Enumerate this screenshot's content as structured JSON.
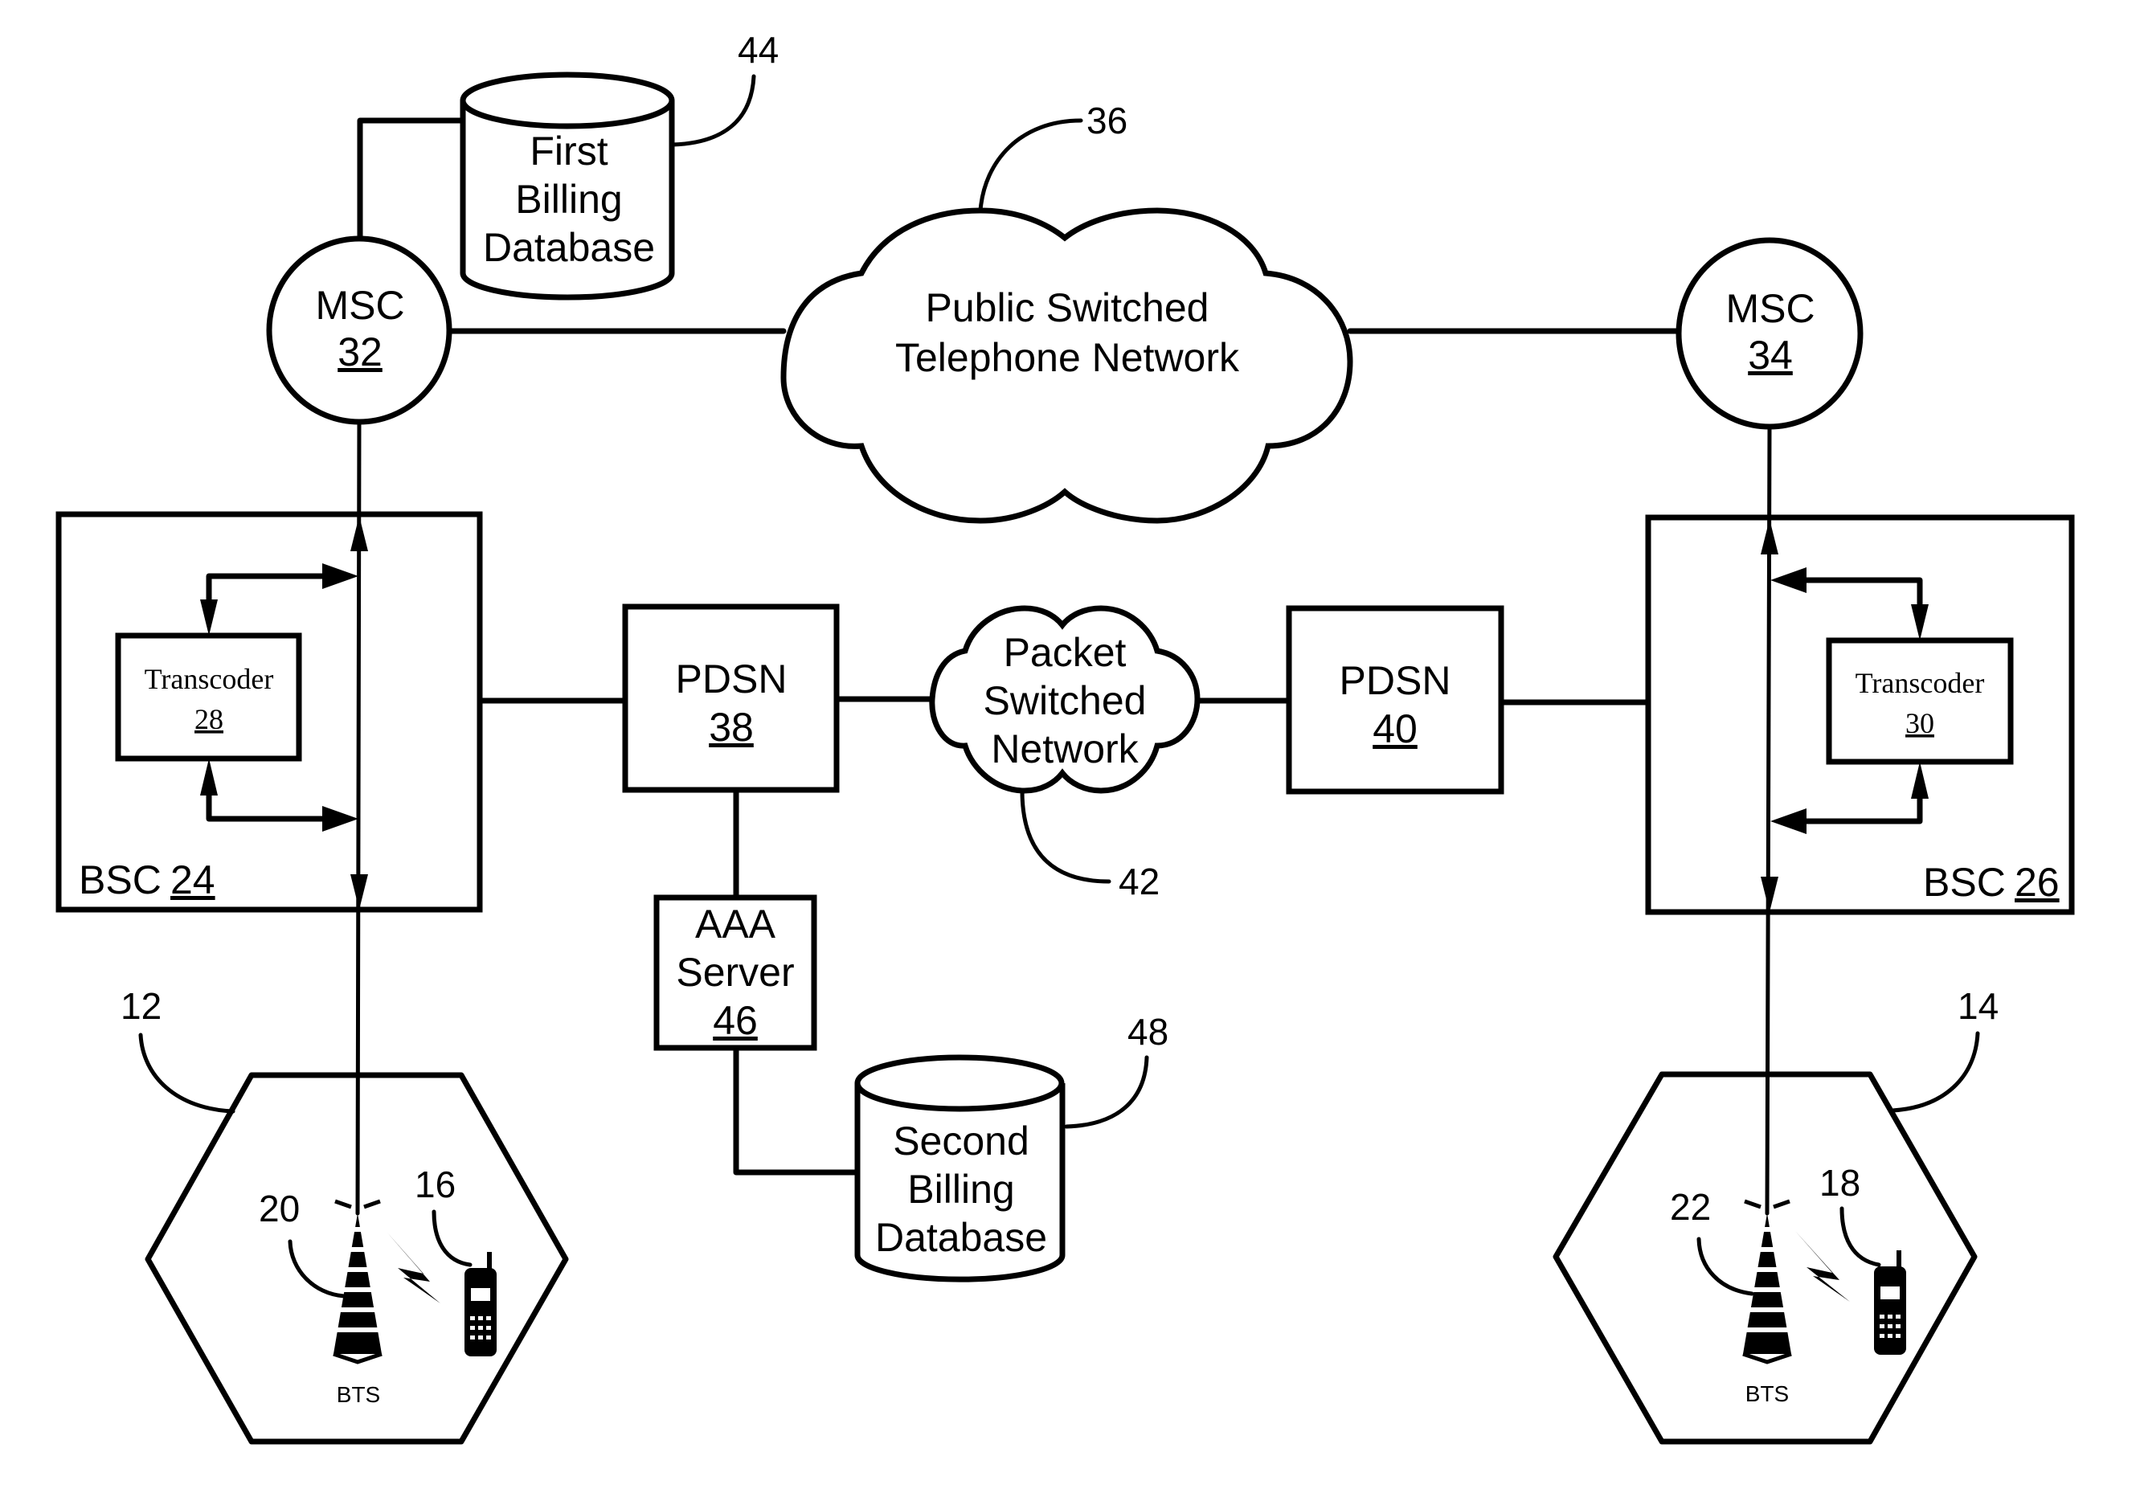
{
  "figure": {
    "msc_left": {
      "name": "MSC",
      "ref": "32"
    },
    "msc_right": {
      "name": "MSC",
      "ref": "34"
    },
    "pstn": {
      "lines": [
        "Public Switched",
        "Telephone Network"
      ],
      "ref": "36"
    },
    "first_db": {
      "lines": [
        "First",
        "Billing",
        "Database"
      ],
      "ref": "44"
    },
    "bsc_left": {
      "name": "BSC",
      "ref": "24"
    },
    "bsc_right": {
      "name": "BSC",
      "ref": "26"
    },
    "transcoder_left": {
      "name": "Transcoder",
      "ref": "28"
    },
    "transcoder_right": {
      "name": "Transcoder",
      "ref": "30"
    },
    "pdsn_left": {
      "name": "PDSN",
      "ref": "38"
    },
    "pdsn_right": {
      "name": "PDSN",
      "ref": "40"
    },
    "psn": {
      "lines": [
        "Packet",
        "Switched",
        "Network"
      ],
      "ref": "42"
    },
    "aaa": {
      "lines": [
        "AAA",
        "Server"
      ],
      "ref": "46"
    },
    "second_db": {
      "lines": [
        "Second",
        "Billing",
        "Database"
      ],
      "ref": "48"
    },
    "cell_left": {
      "ref": "12",
      "bts_ref": "20",
      "mobile_ref": "16",
      "bts_label": "BTS"
    },
    "cell_right": {
      "ref": "14",
      "bts_ref": "22",
      "mobile_ref": "18",
      "bts_label": "BTS"
    }
  }
}
